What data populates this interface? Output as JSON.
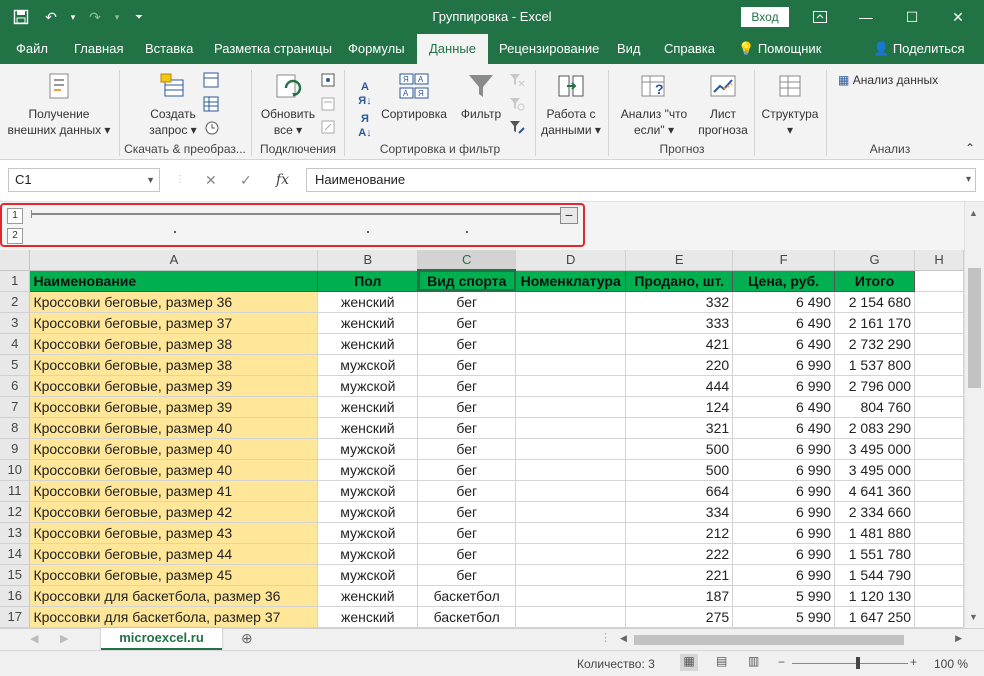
{
  "window": {
    "title": "Группировка  -  Excel",
    "signin": "Вход"
  },
  "tabs": [
    "Файл",
    "Главная",
    "Вставка",
    "Разметка страницы",
    "Формулы",
    "Данные",
    "Рецензирование",
    "Вид",
    "Справка",
    "Помощник",
    "Поделиться"
  ],
  "active_tab": "Данные",
  "ribbon": {
    "get_external": [
      "Получение",
      "внешних данных"
    ],
    "create_query": [
      "Создать",
      "запрос"
    ],
    "refresh_all": [
      "Обновить",
      "все"
    ],
    "sort": "Сортировка",
    "filter": "Фильтр",
    "data_tools": [
      "Работа с",
      "данными"
    ],
    "whatif": [
      "Анализ \"что",
      "если\""
    ],
    "forecast": [
      "Лист",
      "прогноза"
    ],
    "structure": "Структура",
    "data_analysis": "Анализ данных",
    "groups": {
      "get_transform": "Скачать & преобраз...",
      "connections": "Подключения",
      "sort_filter": "Сортировка и фильтр",
      "forecast": "Прогноз",
      "analysis": "Анализ"
    }
  },
  "formula_bar": {
    "name_box": "C1",
    "fx": "fx",
    "content": "Наименование"
  },
  "outline": {
    "levels": [
      "1",
      "2"
    ],
    "collapse": "−"
  },
  "columns": [
    "A",
    "B",
    "C",
    "D",
    "E",
    "F",
    "G",
    "H"
  ],
  "header_row": [
    "Наименование",
    "Пол",
    "Вид спорта",
    "Номенклатура",
    "Продано, шт.",
    "Цена, руб.",
    "Итого"
  ],
  "rows": [
    [
      "Кроссовки беговые, размер 36",
      "женский",
      "бег",
      "",
      "332",
      "6 490",
      "2 154 680"
    ],
    [
      "Кроссовки беговые, размер 37",
      "женский",
      "бег",
      "",
      "333",
      "6 490",
      "2 161 170"
    ],
    [
      "Кроссовки беговые, размер 38",
      "женский",
      "бег",
      "",
      "421",
      "6 490",
      "2 732 290"
    ],
    [
      "Кроссовки беговые, размер 38",
      "мужской",
      "бег",
      "",
      "220",
      "6 990",
      "1 537 800"
    ],
    [
      "Кроссовки беговые, размер 39",
      "мужской",
      "бег",
      "",
      "444",
      "6 990",
      "2 796 000"
    ],
    [
      "Кроссовки беговые, размер 39",
      "женский",
      "бег",
      "",
      "124",
      "6 490",
      "804 760"
    ],
    [
      "Кроссовки беговые, размер 40",
      "женский",
      "бег",
      "",
      "321",
      "6 490",
      "2 083 290"
    ],
    [
      "Кроссовки беговые, размер 40",
      "мужской",
      "бег",
      "",
      "500",
      "6 990",
      "3 495 000"
    ],
    [
      "Кроссовки беговые, размер 40",
      "мужской",
      "бег",
      "",
      "500",
      "6 990",
      "3 495 000"
    ],
    [
      "Кроссовки беговые, размер 41",
      "мужской",
      "бег",
      "",
      "664",
      "6 990",
      "4 641 360"
    ],
    [
      "Кроссовки беговые, размер 42",
      "мужской",
      "бег",
      "",
      "334",
      "6 990",
      "2 334 660"
    ],
    [
      "Кроссовки беговые, размер 43",
      "мужской",
      "бег",
      "",
      "212",
      "6 990",
      "1 481 880"
    ],
    [
      "Кроссовки беговые, размер 44",
      "мужской",
      "бег",
      "",
      "222",
      "6 990",
      "1 551 780"
    ],
    [
      "Кроссовки беговые, размер 45",
      "мужской",
      "бег",
      "",
      "221",
      "6 990",
      "1 544 790"
    ],
    [
      "Кроссовки для баскетбола, размер 36",
      "женский",
      "баскетбол",
      "",
      "187",
      "5 990",
      "1 120 130"
    ],
    [
      "Кроссовки для баскетбола, размер 37",
      "женский",
      "баскетбол",
      "",
      "275",
      "5 990",
      "1 647 250"
    ]
  ],
  "sheet_tab": "microexcel.ru",
  "status": {
    "count": "Количество: 3",
    "zoom": "100 %"
  },
  "colors": {
    "excel_green": "#217346",
    "header_fill": "#00b050",
    "name_fill": "#ffe699",
    "outline_highlight": "#e0282e"
  }
}
